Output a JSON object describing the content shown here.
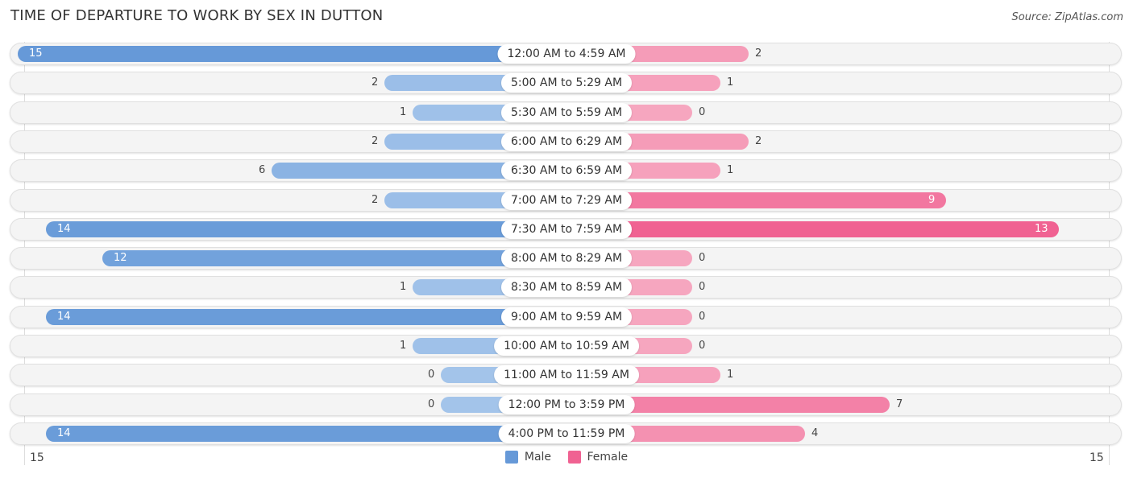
{
  "chart_data": {
    "type": "bar",
    "orientation": "horizontal-diverging",
    "title": "TIME OF DEPARTURE TO WORK BY SEX IN DUTTON",
    "source": "Source: ZipAtlas.com",
    "categories": [
      "12:00 AM to 4:59 AM",
      "5:00 AM to 5:29 AM",
      "5:30 AM to 5:59 AM",
      "6:00 AM to 6:29 AM",
      "6:30 AM to 6:59 AM",
      "7:00 AM to 7:29 AM",
      "7:30 AM to 7:59 AM",
      "8:00 AM to 8:29 AM",
      "8:30 AM to 8:59 AM",
      "9:00 AM to 9:59 AM",
      "10:00 AM to 10:59 AM",
      "11:00 AM to 11:59 AM",
      "12:00 PM to 3:59 PM",
      "4:00 PM to 11:59 PM"
    ],
    "series": [
      {
        "name": "Male",
        "side": "left",
        "values": [
          15,
          2,
          1,
          2,
          6,
          2,
          14,
          12,
          1,
          14,
          1,
          0,
          0,
          14
        ]
      },
      {
        "name": "Female",
        "side": "right",
        "values": [
          2,
          1,
          0,
          2,
          1,
          9,
          13,
          0,
          0,
          0,
          0,
          1,
          7,
          4
        ]
      }
    ],
    "axis": {
      "left_max": 15,
      "right_max": 15,
      "left_tick_label": "15",
      "right_tick_label": "15"
    },
    "legend": {
      "position": "bottom-center",
      "entries": [
        "Male",
        "Female"
      ]
    },
    "colors": {
      "male_strong": "#6699d8",
      "male_light": "#a3c4ea",
      "female_strong": "#f06292",
      "female_light": "#f6a6bf"
    },
    "grid": false
  }
}
